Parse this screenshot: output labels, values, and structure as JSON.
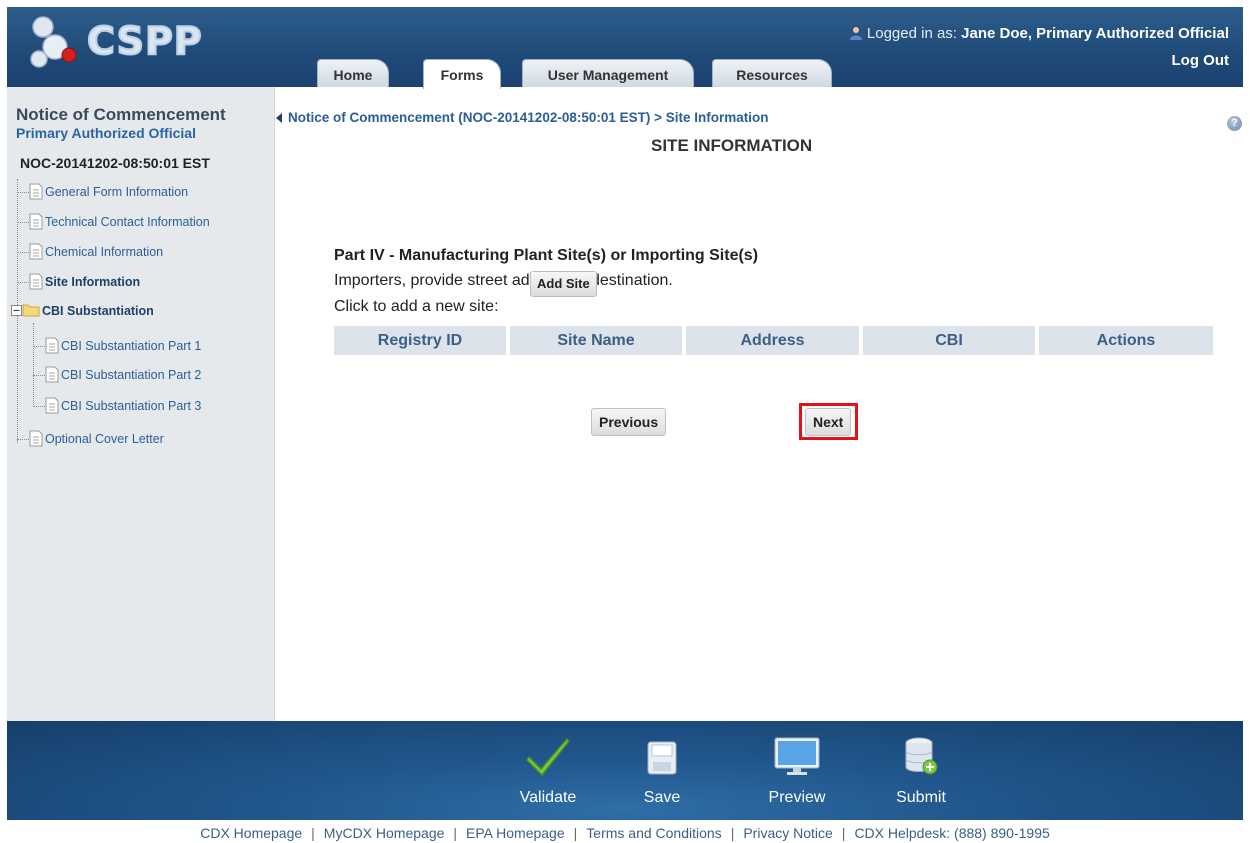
{
  "header": {
    "logo_text": "CSPP",
    "logged_in_prefix": "Logged in as:",
    "user_name": "Jane Doe, Primary Authorized Official",
    "logout_label": "Log Out",
    "tabs": [
      {
        "label": "Home",
        "active": false
      },
      {
        "label": "Forms",
        "active": true
      },
      {
        "label": "User Management",
        "active": false
      },
      {
        "label": "Resources",
        "active": false
      }
    ]
  },
  "sidebar": {
    "title": "Notice of Commencement",
    "subtitle": "Primary Authorized Official",
    "form_id": "NOC-20141202-08:50:01 EST",
    "items": [
      {
        "label": "General Form Information"
      },
      {
        "label": "Technical Contact Information"
      },
      {
        "label": "Chemical Information"
      },
      {
        "label": "Site Information",
        "selected": true
      },
      {
        "label": "CBI Substantiation",
        "folder": true
      },
      {
        "label": "CBI Substantiation Part 1"
      },
      {
        "label": "CBI Substantiation Part 2"
      },
      {
        "label": "CBI Substantiation Part 3"
      },
      {
        "label": "Optional Cover Letter"
      }
    ]
  },
  "main": {
    "breadcrumb": "Notice of Commencement (NOC-20141202-08:50:01 EST) > Site Information",
    "page_title": "SITE INFORMATION",
    "part_title": "Part IV - Manufacturing Plant Site(s) or Importing Site(s)",
    "instruction": "Importers, provide street address of destination.",
    "add_prompt": "Click to add a new site:",
    "add_site_label": "Add Site",
    "table_headers": [
      "Registry ID",
      "Site Name",
      "Address",
      "CBI",
      "Actions"
    ],
    "previous_label": "Previous",
    "next_label": "Next"
  },
  "actions": [
    {
      "label": "Validate",
      "icon": "checkmark-icon"
    },
    {
      "label": "Save",
      "icon": "floppy-disk-icon"
    },
    {
      "label": "Preview",
      "icon": "monitor-icon"
    },
    {
      "label": "Submit",
      "icon": "database-submit-icon"
    }
  ],
  "footer_links": [
    "CDX Homepage",
    "MyCDX Homepage",
    "EPA Homepage",
    "Terms and Conditions",
    "Privacy Notice",
    "CDX Helpdesk: (888) 890-1995"
  ],
  "colors": {
    "header_blue": "#1f4a78",
    "link_blue": "#2b5e98",
    "highlight_red": "#e0121a",
    "table_header_bg": "#dde3ea"
  }
}
